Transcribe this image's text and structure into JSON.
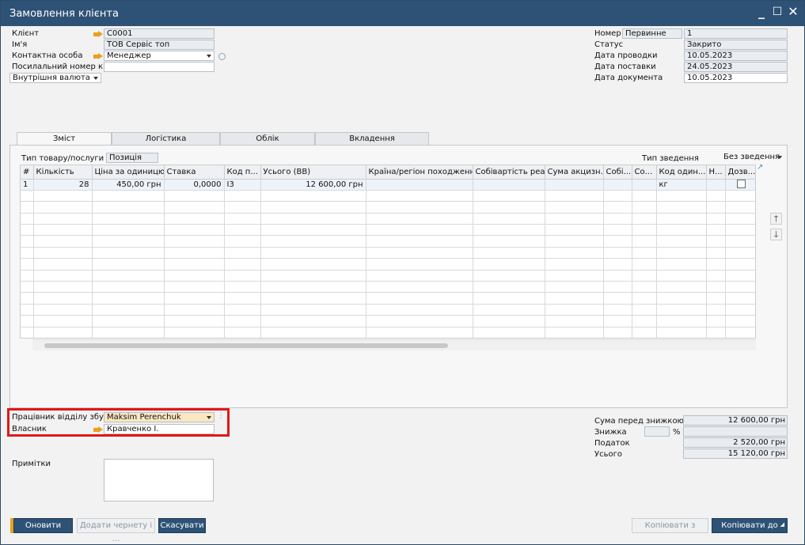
{
  "window": {
    "title": "Замовлення клієнта"
  },
  "header_left": {
    "client_label": "Клієнт",
    "client_value": "C0001",
    "name_label": "Ім'я",
    "name_value": "ТОВ Сервіс топ",
    "contact_label": "Контактна особа",
    "contact_value": "Менеджер",
    "ref_label": "Посилальний номер к",
    "ref_value": "",
    "currency_value": "Внутрішня валюта"
  },
  "header_right": {
    "number_label": "Номер",
    "number_series": "Первинне",
    "number_value": "1",
    "status_label": "Статус",
    "status_value": "Закрито",
    "posting_label": "Дата проводки",
    "posting_value": "10.05.2023",
    "delivery_label": "Дата поставки",
    "delivery_value": "24.05.2023",
    "docdate_label": "Дата документа",
    "docdate_value": "10.05.2023"
  },
  "tabs": [
    {
      "label": "Зміст"
    },
    {
      "label": "Логістика"
    },
    {
      "label": "Облік"
    },
    {
      "label": "Вкладення"
    }
  ],
  "content": {
    "item_type_label": "Тип товару/послуги",
    "item_type_value": "Позиція",
    "summary_type_label": "Тип зведення",
    "summary_type_value": "Без зведення"
  },
  "grid": {
    "columns": [
      "#",
      "Кількість",
      "Ціна за одиницю",
      "Ставка",
      "Код п...",
      "Усього (ВВ)",
      "Країна/регіон походження",
      "Собівартість реа...",
      "Сума акцизн...",
      "Собі...",
      "Со...",
      "Код один...",
      "Н...",
      "Дозв..."
    ],
    "rows": [
      {
        "num": "1",
        "qty": "28",
        "price": "450,00 грн",
        "rate": "0,0000",
        "taxcode": "I3",
        "total": "12 600,00 грн",
        "country": "",
        "cost": "",
        "excise": "",
        "c9": "",
        "c10": "",
        "uom": "кг",
        "c12": ""
      }
    ]
  },
  "footer_left": {
    "sales_emp_label": "Працівник відділу збуту",
    "sales_emp_value": "Maksim Perenchuk",
    "owner_label": "Власник",
    "owner_value": "Кравченко І.",
    "notes_label": "Примітки",
    "notes_value": ""
  },
  "totals": {
    "before_discount_label": "Сума перед знижкою",
    "before_discount_value": "12 600,00 грн",
    "discount_label": "Знижка",
    "discount_pct_sign": "%",
    "discount_value": "",
    "tax_label": "Податок",
    "tax_value": "2 520,00 грн",
    "total_label": "Усього",
    "total_value": "15 120,00 грн"
  },
  "buttons": {
    "update": "Оновити",
    "add_draft": "Додати чернету і ...",
    "cancel": "Скасувати",
    "copy_from": "Копіювати з",
    "copy_to": "Копіювати до"
  }
}
